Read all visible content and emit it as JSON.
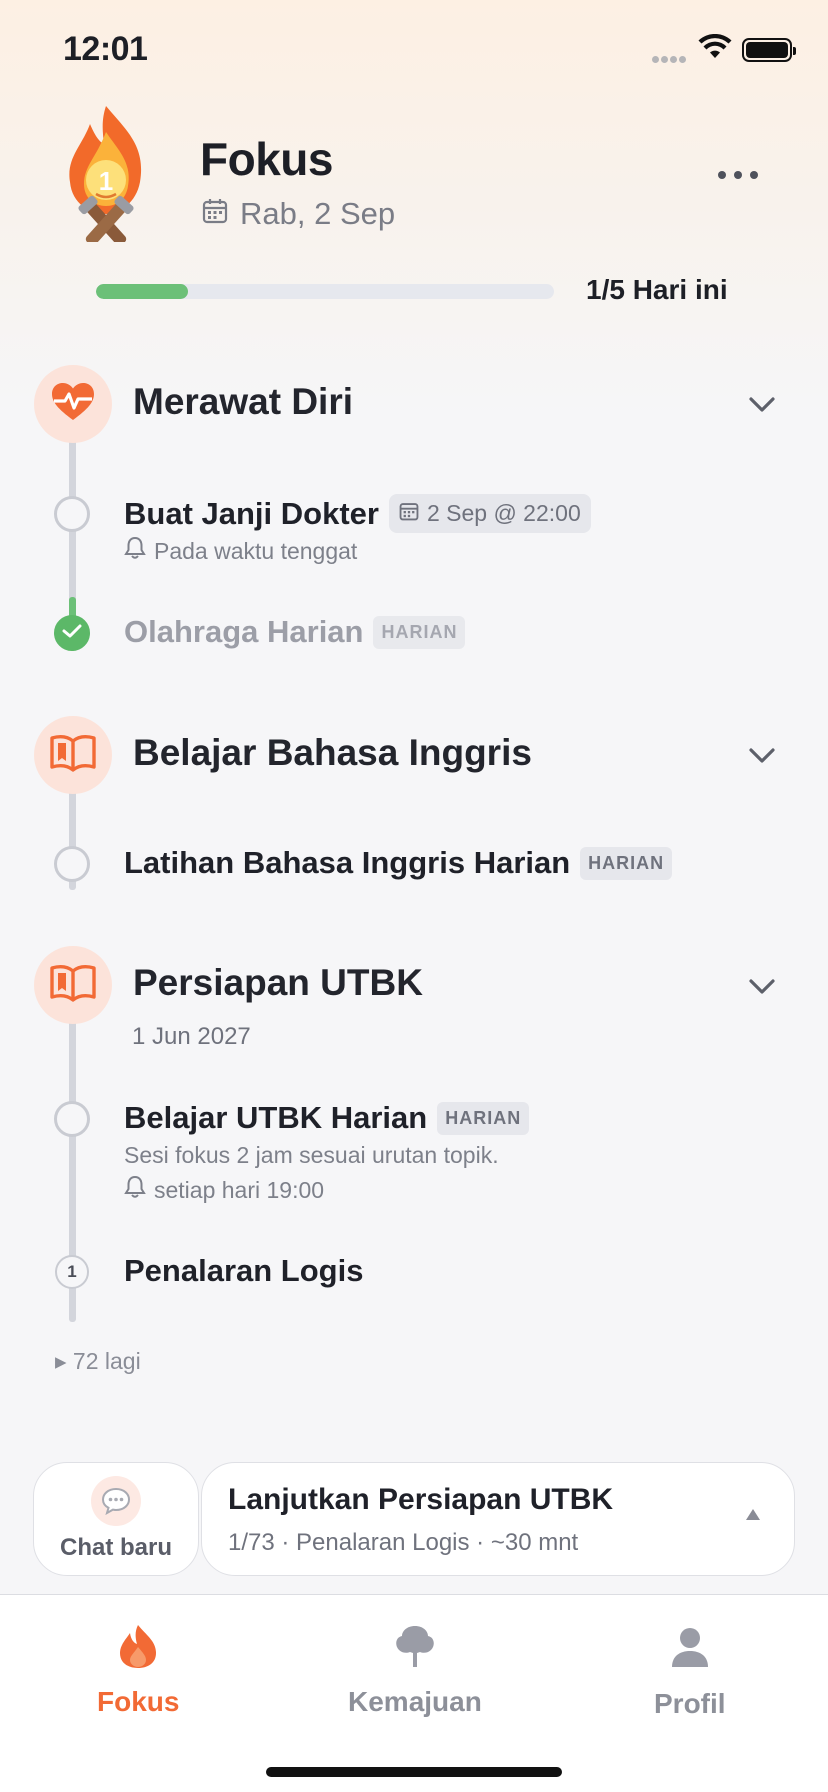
{
  "status": {
    "time": "12:01"
  },
  "header": {
    "title": "Fokus",
    "date": "Rab, 2 Sep",
    "logo_number": "1"
  },
  "progress": {
    "fraction": 0.2,
    "label": "1/5 Hari ini"
  },
  "groups": [
    {
      "title": "Merawat Diri",
      "icon": "heart-pulse-icon",
      "tasks": [
        {
          "title": "Buat Janji Dokter",
          "due": "2 Sep @ 22:00",
          "reminder": "Pada waktu tenggat",
          "done": false
        },
        {
          "title": "Olahraga Harian",
          "badge": "HARIAN",
          "done": true
        }
      ]
    },
    {
      "title": "Belajar Bahasa Inggris",
      "icon": "book-open-icon",
      "tasks": [
        {
          "title": "Latihan Bahasa Inggris Harian",
          "badge": "HARIAN",
          "done": false
        }
      ]
    },
    {
      "title": "Persiapan UTBK",
      "icon": "book-open-icon",
      "date": "1 Jun 2027",
      "tasks": [
        {
          "title": "Belajar UTBK Harian",
          "badge": "HARIAN",
          "description": "Sesi fokus 2 jam sesuai urutan topik.",
          "reminder": "setiap hari 19:00",
          "done": false
        },
        {
          "title": "Penalaran Logis",
          "step": "1",
          "done": false
        }
      ],
      "more": "▸ 72 lagi"
    }
  ],
  "bottom": {
    "chat_label": "Chat baru",
    "continue_title": "Lanjutkan Persiapan UTBK",
    "continue_sub": "1/73 · Penalaran Logis · ~30 mnt"
  },
  "tabs": [
    {
      "label": "Fokus",
      "icon": "flame-icon",
      "active": true
    },
    {
      "label": "Kemajuan",
      "icon": "tree-icon",
      "active": false
    },
    {
      "label": "Profil",
      "icon": "person-icon",
      "active": false
    }
  ],
  "colors": {
    "accent": "#f26a35",
    "progress": "#6cc078",
    "done": "#5cb868"
  }
}
